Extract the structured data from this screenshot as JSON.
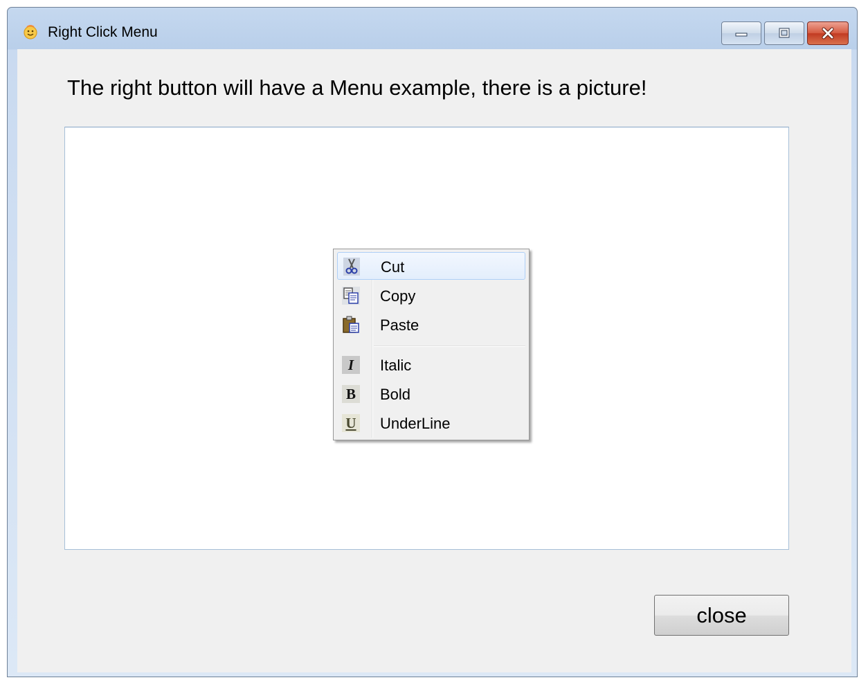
{
  "window": {
    "title": "Right Click Menu",
    "app_icon": "smiley-face-icon",
    "controls": [
      "minimize-icon",
      "maximize-icon",
      "close-icon"
    ]
  },
  "main": {
    "heading": "The right button will have a Menu example, there is a picture!",
    "close_label": "close"
  },
  "context_menu": {
    "items": [
      {
        "label": "Cut",
        "icon": "scissors-icon",
        "highlighted": true
      },
      {
        "label": "Copy",
        "icon": "copy-icon"
      },
      {
        "label": "Paste",
        "icon": "paste-icon"
      },
      {
        "label": "Italic",
        "icon": "italic-icon",
        "glyph": "I"
      },
      {
        "label": "Bold",
        "icon": "bold-icon",
        "glyph": "B"
      },
      {
        "label": "UnderLine",
        "icon": "underline-icon",
        "glyph": "U"
      }
    ]
  },
  "colors": {
    "menu_highlight_border": "#aecff7",
    "window_frame": "#c5d8ef",
    "close_button_red": "#c13a22"
  }
}
